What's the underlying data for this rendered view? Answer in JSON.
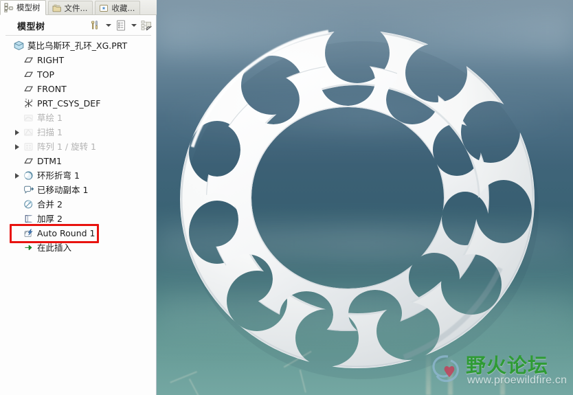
{
  "tabs": [
    {
      "label": "模型树",
      "icon": "tree-icon",
      "active": true
    },
    {
      "label": "文件...",
      "icon": "folder-icon",
      "active": false
    },
    {
      "label": "收藏...",
      "icon": "favorites-icon",
      "active": false
    }
  ],
  "panel": {
    "title": "模型树",
    "tools": [
      {
        "name": "settings-tools-icon",
        "label": "工具"
      },
      {
        "name": "tree-columns-icon",
        "label": "树列"
      },
      {
        "name": "tree-filter-off-icon",
        "label": "显示"
      }
    ]
  },
  "tree": [
    {
      "label": "莫比乌斯环_孔环_XG.PRT",
      "icon": "part-icon",
      "indent": 0,
      "expand": false,
      "dim": false
    },
    {
      "label": "RIGHT",
      "icon": "datum-plane-icon",
      "indent": 1,
      "expand": false,
      "dim": false
    },
    {
      "label": "TOP",
      "icon": "datum-plane-icon",
      "indent": 1,
      "expand": false,
      "dim": false
    },
    {
      "label": "FRONT",
      "icon": "datum-plane-icon",
      "indent": 1,
      "expand": false,
      "dim": false
    },
    {
      "label": "PRT_CSYS_DEF",
      "icon": "coordinate-system-icon",
      "indent": 1,
      "expand": false,
      "dim": false
    },
    {
      "label": "草绘 1",
      "icon": "sketch-icon",
      "indent": 1,
      "expand": false,
      "dim": true
    },
    {
      "label": "扫描 1",
      "icon": "sweep-icon",
      "indent": 1,
      "expand": true,
      "dim": true
    },
    {
      "label": "阵列 1 / 旋转 1",
      "icon": "pattern-icon",
      "indent": 1,
      "expand": true,
      "dim": true
    },
    {
      "label": "DTM1",
      "icon": "datum-plane-icon",
      "indent": 1,
      "expand": false,
      "dim": false
    },
    {
      "label": "环形折弯 1",
      "icon": "toroidal-bend-icon",
      "indent": 1,
      "expand": true,
      "dim": false
    },
    {
      "label": "已移动副本 1",
      "icon": "moved-copy-icon",
      "indent": 1,
      "expand": false,
      "dim": false
    },
    {
      "label": "合并 2",
      "icon": "merge-icon",
      "indent": 1,
      "expand": false,
      "dim": false
    },
    {
      "label": "加厚 2",
      "icon": "thicken-icon",
      "indent": 1,
      "expand": false,
      "dim": false
    },
    {
      "label": "Auto Round 1",
      "icon": "auto-round-icon",
      "indent": 1,
      "expand": false,
      "dim": false,
      "highlight": true
    },
    {
      "label": "在此插入",
      "icon": "insert-here-icon",
      "indent": 1,
      "expand": false,
      "dim": false
    }
  ],
  "highlight_color": "#e8130f",
  "watermark": {
    "title": "野火论坛",
    "url": "www.proewildfire.cn",
    "title_color": "#2f9b35"
  },
  "viewport": {
    "model_name": "莫比乌斯环 孔环",
    "background": "sky-photo-backdrop"
  }
}
